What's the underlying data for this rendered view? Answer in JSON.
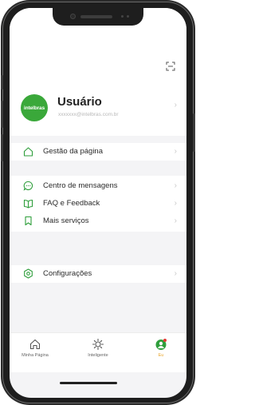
{
  "profile": {
    "avatar_text": "intelbras",
    "name": "Usuário",
    "email": "xxxxxxx@intelbras.com.br"
  },
  "menu": {
    "page_management": "Gestão da página",
    "messages": "Centro de mensagens",
    "faq": "FAQ e Feedback",
    "more_services": "Mais serviços",
    "settings": "Configurações"
  },
  "tabs": [
    {
      "label": "Minha Página",
      "icon": "home-icon"
    },
    {
      "label": "Inteligente",
      "icon": "sun-icon"
    },
    {
      "label": "Eu",
      "icon": "profile-icon"
    }
  ],
  "colors": {
    "accent": "#3aa83a",
    "active_tab": "#e9a62a",
    "notification_dot": "#e53935"
  }
}
